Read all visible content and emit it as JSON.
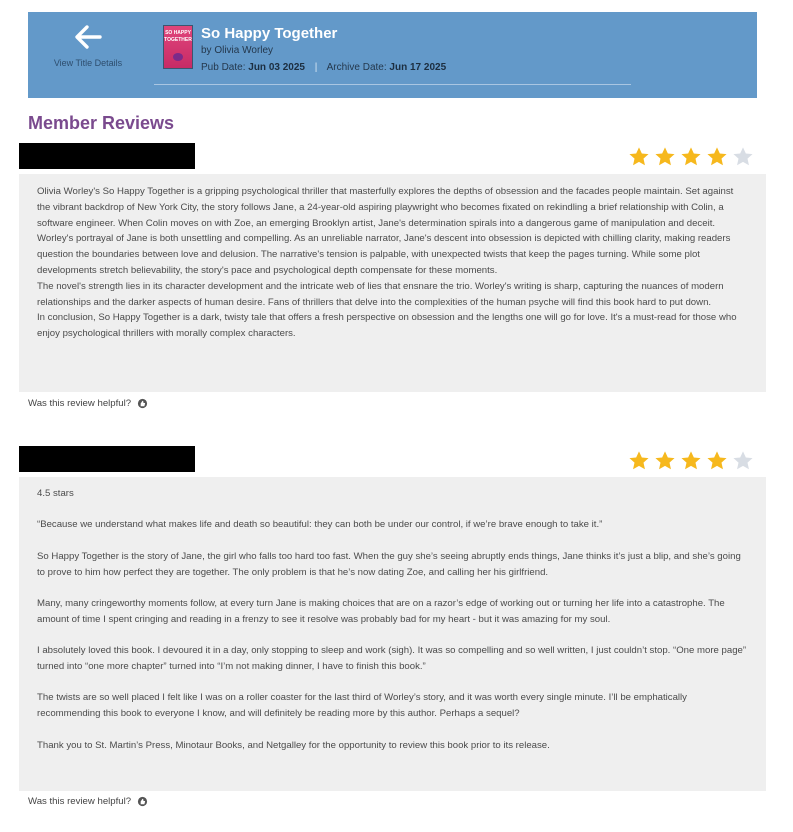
{
  "header": {
    "back_label": "View Title Details",
    "cover_line1": "SO HAPPY",
    "cover_line2": "TOGETHER",
    "title": "So Happy Together",
    "author": "by Olivia Worley",
    "pub_date_label": "Pub Date:",
    "pub_date": "Jun 03 2025",
    "separator": "|",
    "archive_date_label": "Archive Date:",
    "archive_date": "Jun 17 2025"
  },
  "section_title": "Member Reviews",
  "colors": {
    "header_bg": "#6399c9",
    "section_title": "#7a4a8e",
    "star_filled": "#f6b81d",
    "star_empty": "#d8dde4",
    "review_bg": "#efefef"
  },
  "reviews": [
    {
      "rating": 4,
      "max_rating": 5,
      "paragraphs": [
        "Olivia Worley's So Happy Together is a gripping psychological thriller that masterfully explores the depths of obsession and the facades people maintain. Set against the vibrant backdrop of New York City, the story follows Jane, a 24-year-old aspiring playwright who becomes fixated on rekindling a brief relationship with Colin, a software engineer. When Colin moves on with Zoe, an emerging Brooklyn artist, Jane's determination spirals into a dangerous game of manipulation and deceit.",
        "Worley's portrayal of Jane is both unsettling and compelling. As an unreliable narrator, Jane's descent into obsession is depicted with chilling clarity, making readers question the boundaries between love and delusion. The narrative's tension is palpable, with unexpected twists that keep the pages turning. While some plot developments stretch believability, the story's pace and psychological depth compensate for these moments.",
        "The novel's strength lies in its character development and the intricate web of lies that ensnare the trio. Worley's writing is sharp, capturing the nuances of modern relationships and the darker aspects of human desire. Fans of thrillers that delve into the complexities of the human psyche will find this book hard to put down.",
        "In conclusion, So Happy Together is a dark, twisty tale that offers a fresh perspective on obsession and the lengths one will go for love. It's a must-read for those who enjoy psychological thrillers with morally complex characters."
      ],
      "helpful_label": "Was this review helpful?"
    },
    {
      "rating": 4,
      "max_rating": 5,
      "paragraphs": [
        "4.5 stars",
        "“Because we understand what makes life and death so beautiful: they can both be under our control, if we’re brave enough to take it.”",
        "So Happy Together is the story of Jane, the girl who falls too hard too fast. When the guy she’s seeing abruptly ends things, Jane thinks it’s just a blip, and she’s going to prove to him how perfect they are together. The only problem is that he’s now dating Zoe, and calling her his girlfriend.",
        "Many, many cringeworthy moments follow, at every turn Jane is making choices that are on a razor’s edge of working out or turning her life into a catastrophe. The amount of time I spent cringing and reading in a frenzy to see it resolve was probably bad for my heart - but it was amazing for my soul.",
        "I absolutely loved this book. I devoured it in a day, only stopping to sleep and work (sigh). It was so compelling and so well written, I just couldn’t stop. “One more page” turned into “one more chapter” turned into “I’m not making dinner, I have to finish this book.”",
        "The twists are so well placed I felt like I was on a roller coaster for the last third of Worley’s story, and it was worth every single minute. I’ll be emphatically recommending this book to everyone I know, and will definitely be reading more by this author. Perhaps a sequel?",
        "Thank you to St. Martin’s Press, Minotaur Books, and Netgalley for the opportunity to review this book prior to its release."
      ],
      "helpful_label": "Was this review helpful?"
    }
  ]
}
